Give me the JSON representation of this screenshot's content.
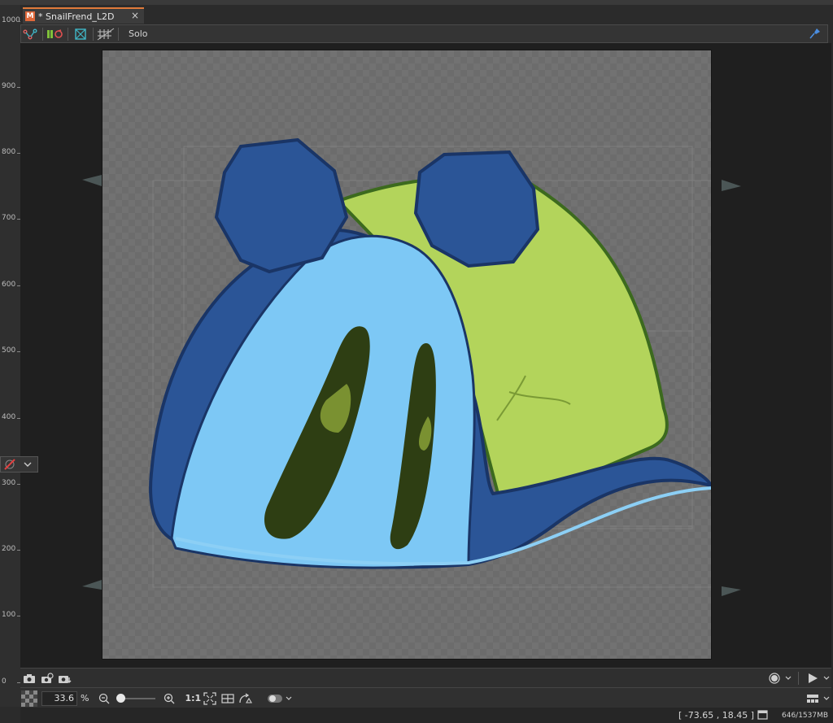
{
  "tab": {
    "title": "* SnailFrend_L2D",
    "close": "×",
    "logo": "M"
  },
  "toolbar": {
    "solo_label": "Solo"
  },
  "ruler": {
    "ticks": [
      "1000",
      "900",
      "800",
      "700",
      "600",
      "500",
      "400",
      "300",
      "200",
      "100",
      "0"
    ]
  },
  "zoom": {
    "value": "33.6",
    "unit": "%",
    "ratio_label": "1:1"
  },
  "status": {
    "coords": "[ -73.65 ,   18.45 ]",
    "memory": "646/1537MB"
  },
  "colors": {
    "shell_green": "#b3d45b",
    "body_blue": "#7dc8f5",
    "dark_blue": "#2b5597",
    "outline": "#1a3566",
    "eye_dark": "#2e3e13",
    "canvas_gray": "#707070"
  }
}
